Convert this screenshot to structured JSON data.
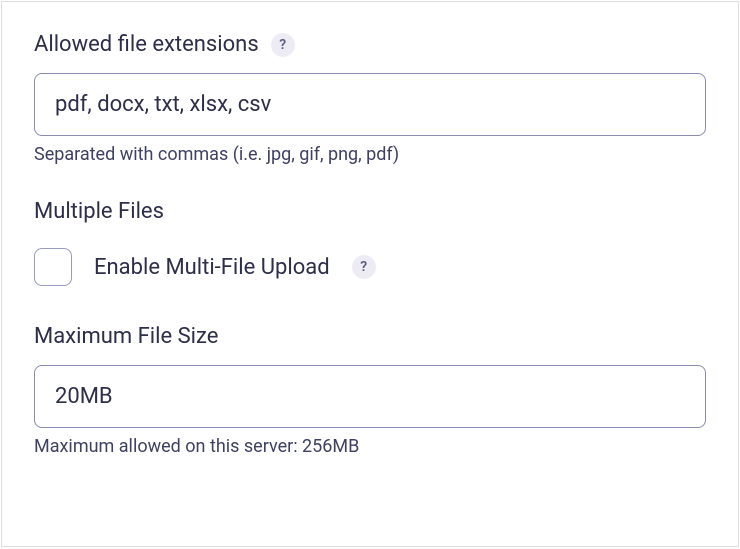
{
  "allowedExtensions": {
    "label": "Allowed file extensions",
    "value": "pdf, docx, txt, xlsx, csv",
    "helper": "Separated with commas (i.e. jpg, gif, png, pdf)",
    "helpGlyph": "?"
  },
  "multipleFiles": {
    "sectionLabel": "Multiple Files",
    "checkboxLabel": "Enable Multi-File Upload",
    "helpGlyph": "?"
  },
  "maxFileSize": {
    "label": "Maximum File Size",
    "value": "20MB",
    "helper": "Maximum allowed on this server: 256MB"
  }
}
